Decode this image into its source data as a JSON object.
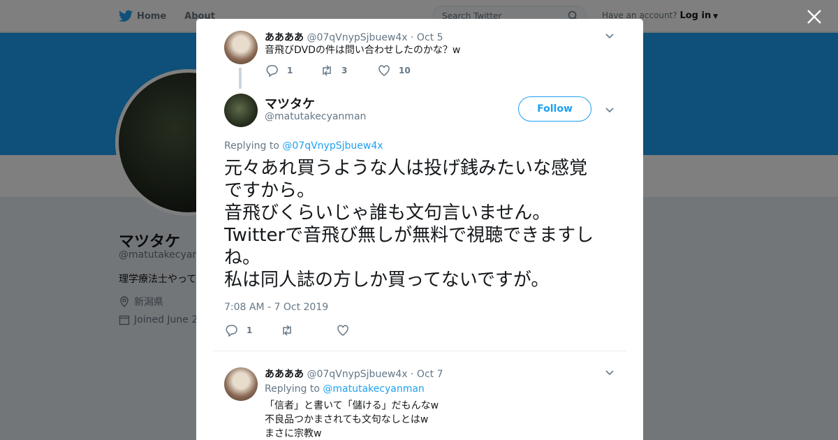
{
  "topbar": {
    "home_label": "Home",
    "about_label": "About",
    "search_placeholder": "Search Twitter",
    "have_account": "Have an account?",
    "login_label": "Log in"
  },
  "profile": {
    "name": "マツタケ",
    "handle": "@matutakecyanm",
    "bio": "理学療法士やって",
    "location": "新潟県",
    "joined": "Joined June 2"
  },
  "modal": {
    "parent_tweet": {
      "name": "ああああ",
      "handle": "@07qVnypSjbuew4x",
      "date": "· Oct 5",
      "text": "音飛びDVDの件は問い合わせしたのかな？w",
      "replies": "1",
      "retweets": "3",
      "likes": "10"
    },
    "main_tweet": {
      "name": "マツタケ",
      "handle": "@matutakecyanman",
      "follow_label": "Follow",
      "replying_prefix": "Replying to",
      "replying_to": "@07qVnypSjbuew4x",
      "lines": [
        "元々あれ買うような人は投げ銭みたいな感覚",
        "ですから。",
        "音飛びくらいじゃ誰も文句言いません。",
        "Twitterで音飛び無しが無料で視聴できますし",
        "ね。",
        "私は同人誌の方しか買ってないですが。"
      ],
      "timestamp": "7:08 AM - 7 Oct 2019",
      "replies": "1"
    },
    "reply_tweet": {
      "name": "ああああ",
      "handle": "@07qVnypSjbuew4x",
      "date": "· Oct 7",
      "replying_prefix": "Replying to",
      "replying_to": "@matutakecyanman",
      "lines": [
        "「信者」と書いて「儲ける」だもんなw",
        "不良品つかまされても文句なしとはw",
        "まさに宗教w"
      ]
    }
  },
  "colors": {
    "accent": "#1da1f2",
    "overlay": "rgba(0,0,0,0.5)"
  }
}
